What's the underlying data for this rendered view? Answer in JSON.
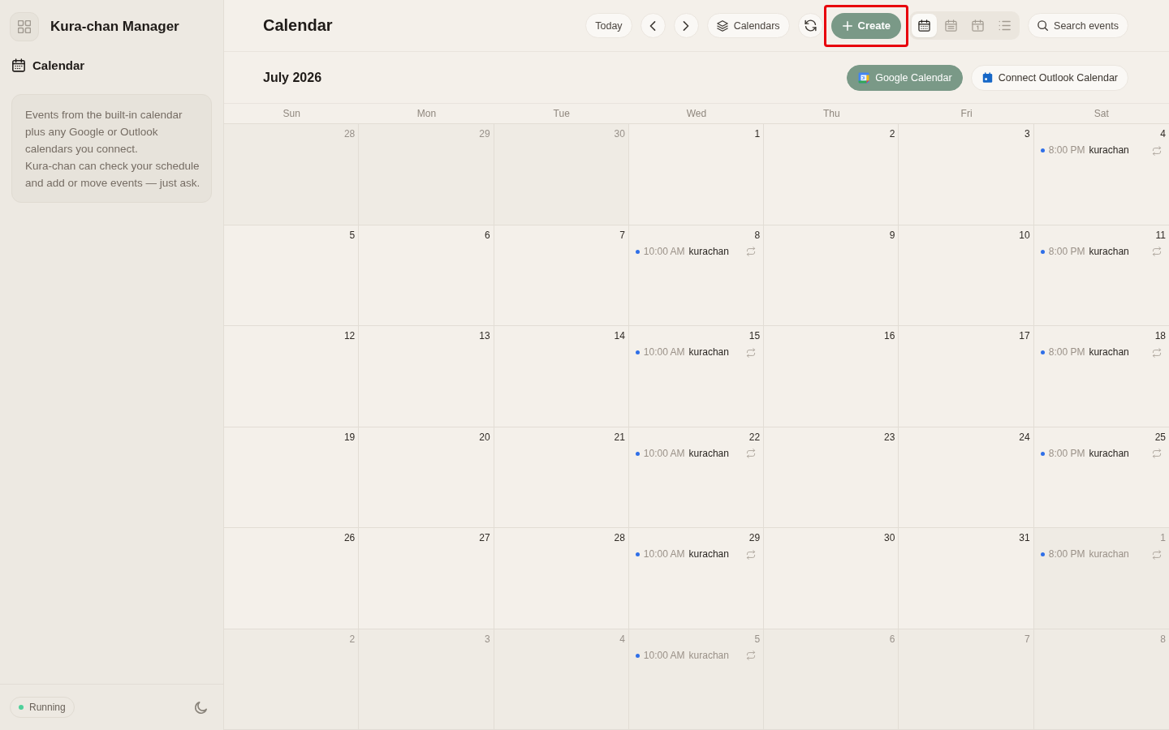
{
  "sidebar": {
    "app_title": "Kura-chan Manager",
    "nav": [
      {
        "label": "Calendar"
      }
    ],
    "info": [
      "Events from the built-in calendar plus any Google or Outlook calendars you connect.",
      "Kura-chan can check your schedule and add or move events — just ask."
    ],
    "status": {
      "label": "Running",
      "running": true
    }
  },
  "header": {
    "title": "Calendar",
    "today": "Today",
    "calendars": "Calendars",
    "create": {
      "label": "Create",
      "highlighted": true
    },
    "views": [
      {
        "kind": "month",
        "selected": true
      },
      {
        "kind": "week",
        "selected": false
      },
      {
        "kind": "day",
        "selected": false
      },
      {
        "kind": "agenda",
        "selected": false
      }
    ],
    "search": {
      "label": "Search events"
    }
  },
  "month_bar": {
    "label": "July 2026",
    "integrations": [
      {
        "kind": "google",
        "label": "Google Calendar",
        "connected": true
      },
      {
        "kind": "outlook",
        "label": "Connect Outlook Calendar",
        "connected": false
      }
    ]
  },
  "calendar": {
    "weekdays": [
      "Sun",
      "Mon",
      "Tue",
      "Wed",
      "Thu",
      "Fri",
      "Sat"
    ],
    "weeks": [
      [
        {
          "date": "28",
          "outside": true
        },
        {
          "date": "29",
          "outside": true
        },
        {
          "date": "30",
          "outside": true
        },
        {
          "date": "1",
          "outside": false
        },
        {
          "date": "2",
          "outside": false
        },
        {
          "date": "3",
          "outside": false
        },
        {
          "date": "4",
          "outside": false,
          "events": [
            {
              "time": "8:00 PM",
              "title": "kurachan",
              "recurring": true
            }
          ]
        }
      ],
      [
        {
          "date": "5",
          "outside": false
        },
        {
          "date": "6",
          "outside": false
        },
        {
          "date": "7",
          "outside": false
        },
        {
          "date": "8",
          "outside": false,
          "events": [
            {
              "time": "10:00 AM",
              "title": "kurachan",
              "recurring": true
            }
          ]
        },
        {
          "date": "9",
          "outside": false
        },
        {
          "date": "10",
          "outside": false
        },
        {
          "date": "11",
          "outside": false,
          "events": [
            {
              "time": "8:00 PM",
              "title": "kurachan",
              "recurring": true
            }
          ]
        }
      ],
      [
        {
          "date": "12",
          "outside": false
        },
        {
          "date": "13",
          "outside": false
        },
        {
          "date": "14",
          "outside": false
        },
        {
          "date": "15",
          "outside": false,
          "events": [
            {
              "time": "10:00 AM",
              "title": "kurachan",
              "recurring": true
            }
          ]
        },
        {
          "date": "16",
          "outside": false
        },
        {
          "date": "17",
          "outside": false
        },
        {
          "date": "18",
          "outside": false,
          "events": [
            {
              "time": "8:00 PM",
              "title": "kurachan",
              "recurring": true
            }
          ]
        }
      ],
      [
        {
          "date": "19",
          "outside": false
        },
        {
          "date": "20",
          "outside": false
        },
        {
          "date": "21",
          "outside": false
        },
        {
          "date": "22",
          "outside": false,
          "events": [
            {
              "time": "10:00 AM",
              "title": "kurachan",
              "recurring": true
            }
          ]
        },
        {
          "date": "23",
          "outside": false
        },
        {
          "date": "24",
          "outside": false
        },
        {
          "date": "25",
          "outside": false,
          "events": [
            {
              "time": "8:00 PM",
              "title": "kurachan",
              "recurring": true
            }
          ]
        }
      ],
      [
        {
          "date": "26",
          "outside": false
        },
        {
          "date": "27",
          "outside": false
        },
        {
          "date": "28",
          "outside": false
        },
        {
          "date": "29",
          "outside": false,
          "events": [
            {
              "time": "10:00 AM",
              "title": "kurachan",
              "recurring": true
            }
          ]
        },
        {
          "date": "30",
          "outside": false
        },
        {
          "date": "31",
          "outside": false
        },
        {
          "date": "1",
          "outside": true,
          "events": [
            {
              "time": "8:00 PM",
              "title": "kurachan",
              "recurring": true
            }
          ]
        }
      ],
      [
        {
          "date": "2",
          "outside": true
        },
        {
          "date": "3",
          "outside": true
        },
        {
          "date": "4",
          "outside": true
        },
        {
          "date": "5",
          "outside": true,
          "events": [
            {
              "time": "10:00 AM",
              "title": "kurachan",
              "recurring": true
            }
          ]
        },
        {
          "date": "6",
          "outside": true
        },
        {
          "date": "7",
          "outside": true
        },
        {
          "date": "8",
          "outside": true
        }
      ]
    ]
  }
}
